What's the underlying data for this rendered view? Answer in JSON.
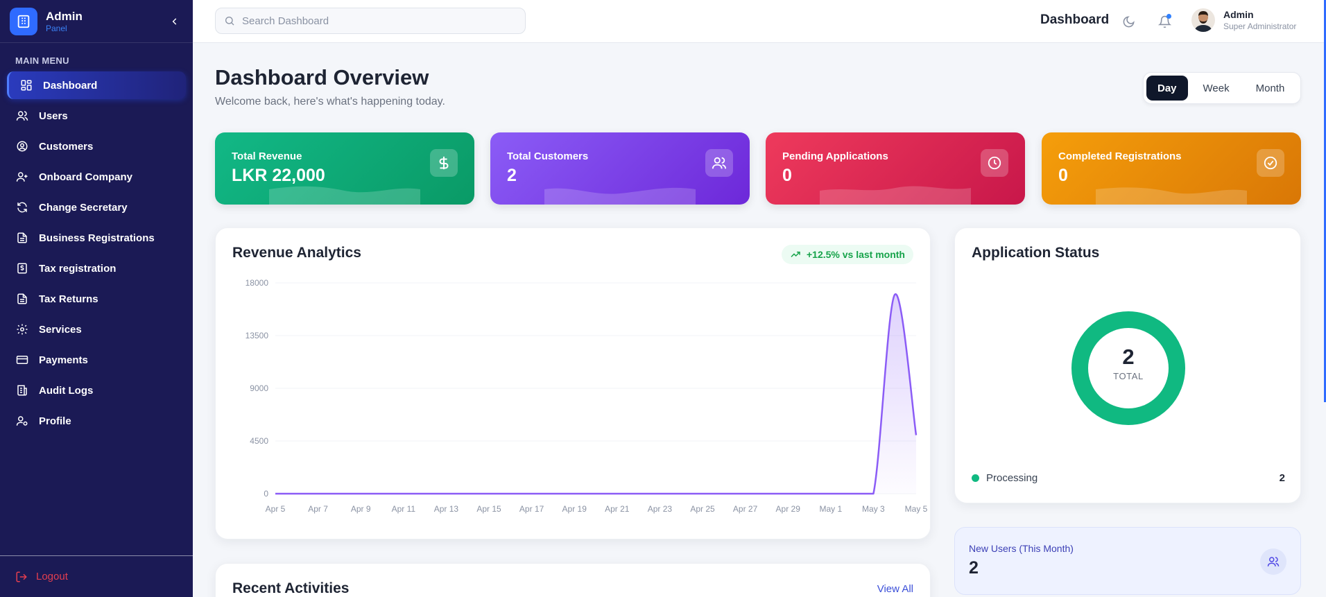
{
  "brand": {
    "title": "Admin",
    "subtitle": "Panel"
  },
  "sidebar": {
    "heading": "MAIN MENU",
    "items": [
      {
        "label": "Dashboard",
        "icon": "dashboard-grid-icon",
        "active": true
      },
      {
        "label": "Users",
        "icon": "users-icon"
      },
      {
        "label": "Customers",
        "icon": "user-circle-icon"
      },
      {
        "label": "Onboard Company",
        "icon": "user-plus-icon"
      },
      {
        "label": "Change Secretary",
        "icon": "refresh-icon"
      },
      {
        "label": "Business Registrations",
        "icon": "document-icon"
      },
      {
        "label": "Tax registration",
        "icon": "receipt-dollar-icon"
      },
      {
        "label": "Tax Returns",
        "icon": "document-icon"
      },
      {
        "label": "Services",
        "icon": "gear-icon"
      },
      {
        "label": "Payments",
        "icon": "credit-card-icon"
      },
      {
        "label": "Audit Logs",
        "icon": "ledger-icon"
      },
      {
        "label": "Profile",
        "icon": "user-cog-icon"
      }
    ],
    "logout_label": "Logout"
  },
  "topbar": {
    "search_placeholder": "Search Dashboard",
    "title": "Dashboard",
    "user_name": "Admin",
    "user_role": "Super Administrator"
  },
  "page": {
    "title": "Dashboard Overview",
    "subtitle": "Welcome back, here's what's happening today.",
    "ranges": [
      "Day",
      "Week",
      "Month"
    ],
    "active_range": "Day"
  },
  "stats": [
    {
      "label": "Total Revenue",
      "value": "LKR 22,000",
      "icon": "dollar-icon",
      "color": "#10b981"
    },
    {
      "label": "Total Customers",
      "value": "2",
      "icon": "users-icon",
      "color": "#7c3aed"
    },
    {
      "label": "Pending Applications",
      "value": "0",
      "icon": "clock-icon",
      "color": "#e11d48"
    },
    {
      "label": "Completed Registrations",
      "value": "0",
      "icon": "check-circle-icon",
      "color": "#f59e0b"
    }
  ],
  "revenue": {
    "title": "Revenue Analytics",
    "badge": "+12.5% vs last month"
  },
  "chart_data": {
    "type": "area",
    "title": "Revenue Analytics",
    "x_ticks": [
      "Apr 5",
      "Apr 7",
      "Apr 9",
      "Apr 11",
      "Apr 13",
      "Apr 15",
      "Apr 17",
      "Apr 19",
      "Apr 21",
      "Apr 23",
      "Apr 25",
      "Apr 27",
      "Apr 29",
      "May 1",
      "May 3",
      "May 5"
    ],
    "x": [
      "Apr 5",
      "Apr 6",
      "Apr 7",
      "Apr 8",
      "Apr 9",
      "Apr 10",
      "Apr 11",
      "Apr 12",
      "Apr 13",
      "Apr 14",
      "Apr 15",
      "Apr 16",
      "Apr 17",
      "Apr 18",
      "Apr 19",
      "Apr 20",
      "Apr 21",
      "Apr 22",
      "Apr 23",
      "Apr 24",
      "Apr 25",
      "Apr 26",
      "Apr 27",
      "Apr 28",
      "Apr 29",
      "Apr 30",
      "May 1",
      "May 2",
      "May 3",
      "May 4",
      "May 5"
    ],
    "values": [
      0,
      0,
      0,
      0,
      0,
      0,
      0,
      0,
      0,
      0,
      0,
      0,
      0,
      0,
      0,
      0,
      0,
      0,
      0,
      0,
      0,
      0,
      0,
      0,
      0,
      0,
      0,
      0,
      0,
      17000,
      5000
    ],
    "y_ticks": [
      0,
      4500,
      9000,
      13500,
      18000
    ],
    "ylim": [
      0,
      18000
    ],
    "color": "#8b5cf6",
    "grid": true
  },
  "status": {
    "title": "Application Status",
    "total": "2",
    "total_label": "TOTAL",
    "legend": [
      {
        "label": "Processing",
        "value": "2",
        "color": "#10b981"
      }
    ]
  },
  "new_users": {
    "label": "New Users (This Month)",
    "value": "2"
  },
  "activities": {
    "title": "Recent Activities",
    "view_all": "View All"
  }
}
